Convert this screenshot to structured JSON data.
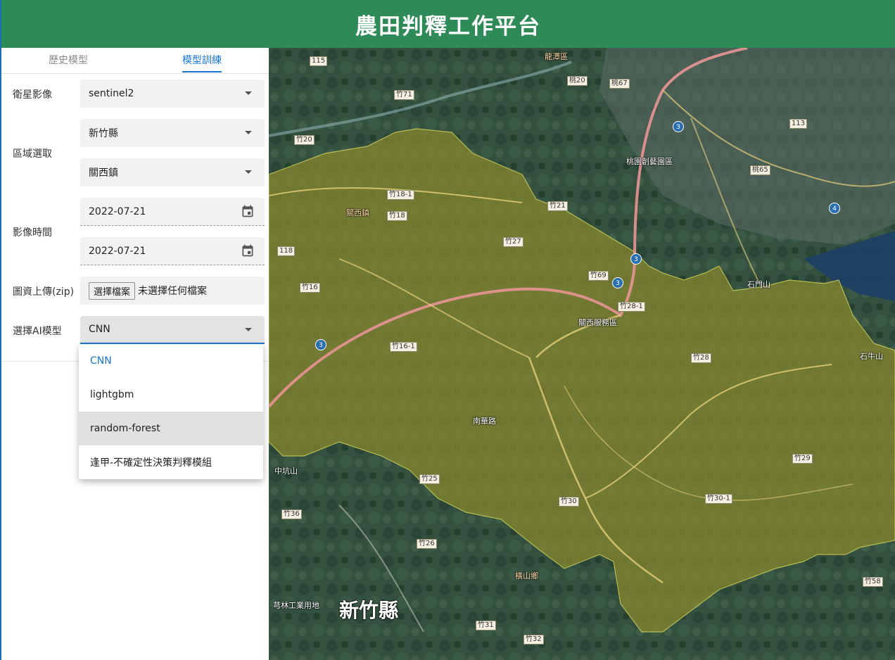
{
  "header": {
    "title": "農田判釋工作平台"
  },
  "tabs": [
    {
      "label": "歷史模型",
      "active": false
    },
    {
      "label": "模型訓練",
      "active": true
    }
  ],
  "form": {
    "satellite": {
      "label": "衛星影像",
      "value": "sentinel2"
    },
    "region": {
      "label": "區域選取",
      "county": "新竹縣",
      "township": "關西鎮"
    },
    "image_time": {
      "label": "影像時間",
      "start": "2022-07-21",
      "end": "2022-07-21"
    },
    "upload": {
      "label": "圖資上傳(zip)",
      "button": "選擇檔案",
      "status": "未選擇任何檔案"
    },
    "ai_model": {
      "label": "選擇AI模型",
      "value": "CNN"
    }
  },
  "dropdown": {
    "options": [
      "CNN",
      "lightgbm",
      "random-forest",
      "逢甲-不確定性決策判釋模組"
    ],
    "selected": "CNN",
    "hovered": "random-forest"
  },
  "map": {
    "labels": {
      "county": "新竹縣",
      "township": "關西鎮",
      "service_area": "關西服務區",
      "longtan": "龍潭區",
      "shimen": "石門山",
      "shiniu": "石牛山",
      "zhongkeng": "中坑山",
      "hengshan": "橫山鄉",
      "qionglin": "芎林工業用地",
      "nanfeng": "南華路",
      "taoyuan": "桃園創藝園區"
    },
    "road_shields": [
      "115",
      "竹71",
      "竹20",
      "竹18-1",
      "竹18",
      "竹27",
      "118",
      "竹16",
      "竹16-1",
      "竹69",
      "竹28-1",
      "竹28",
      "竹25",
      "竹30",
      "竹30-1",
      "竹29",
      "竹36",
      "竹26",
      "竹31",
      "竹32",
      "竹58",
      "桃20",
      "桃67",
      "桃65",
      "113",
      "竹21"
    ],
    "highway_numbers": [
      "3",
      "3",
      "3",
      "4",
      "3"
    ],
    "colors": {
      "boundary": "#e8e85a",
      "fill": "#8a8a2e",
      "highway": "#e88a8a"
    }
  }
}
